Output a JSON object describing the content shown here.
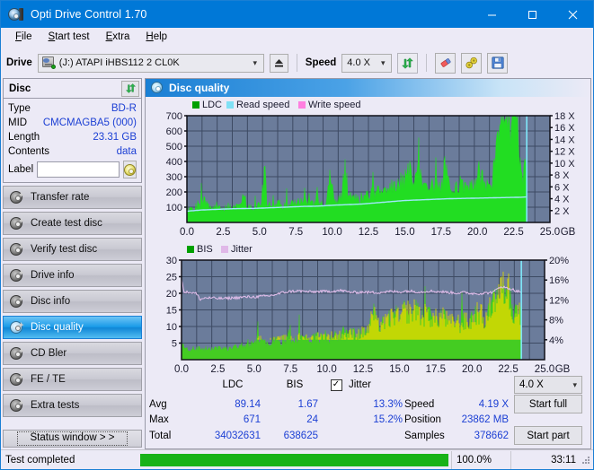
{
  "window": {
    "title": "Opti Drive Control 1.70",
    "icon": "disc-drive-icon",
    "minimize": "minimize",
    "maximize": "maximize",
    "close": "close"
  },
  "menu": [
    {
      "label": "File",
      "accel": "F"
    },
    {
      "label": "Start test",
      "accel": "S"
    },
    {
      "label": "Extra",
      "accel": "E"
    },
    {
      "label": "Help",
      "accel": "H"
    }
  ],
  "toolbar": {
    "drive_label": "Drive",
    "drive_value": "(J:)  ATAPI iHBS112  2 CL0K",
    "eject_icon": "eject-icon",
    "speed_label": "Speed",
    "speed_value": "4.0 X",
    "refresh_icon": "refresh-icon",
    "eraser_icon": "eraser-icon",
    "tools_icon": "tools-icon",
    "save_icon": "save-icon"
  },
  "disc": {
    "title": "Disc",
    "refresh_icon": "refresh-icon",
    "rows": [
      {
        "key": "Type",
        "value": "BD-R"
      },
      {
        "key": "MID",
        "value": "CMCMAGBA5 (000)"
      },
      {
        "key": "Length",
        "value": "23.31 GB"
      },
      {
        "key": "Contents",
        "value": "data"
      }
    ],
    "label_key": "Label",
    "label_value": "",
    "label_placeholder": "",
    "label_btn_icon": "disc-icon"
  },
  "nav": {
    "items": [
      {
        "label": "Transfer rate",
        "icon": "disc-icon",
        "active": false
      },
      {
        "label": "Create test disc",
        "icon": "disc-icon",
        "active": false
      },
      {
        "label": "Verify test disc",
        "icon": "disc-icon",
        "active": false
      },
      {
        "label": "Drive info",
        "icon": "disc-icon",
        "active": false
      },
      {
        "label": "Disc info",
        "icon": "disc-icon",
        "active": false
      },
      {
        "label": "Disc quality",
        "icon": "disc-icon",
        "active": true
      },
      {
        "label": "CD Bler",
        "icon": "disc-icon",
        "active": false
      },
      {
        "label": "FE / TE",
        "icon": "disc-icon",
        "active": false
      },
      {
        "label": "Extra tests",
        "icon": "disc-icon",
        "active": false
      }
    ],
    "status_window": "Status window > >"
  },
  "panel": {
    "title": "Disc quality",
    "icon": "disc-quality-icon"
  },
  "stats": {
    "col_headers": [
      "LDC",
      "BIS"
    ],
    "jitter_label": "Jitter",
    "jitter_checked": true,
    "rows": [
      {
        "key": "Avg",
        "ldc": "89.14",
        "bis": "1.67",
        "jitter": "13.3%"
      },
      {
        "key": "Max",
        "ldc": "671",
        "bis": "24",
        "jitter": "15.2%"
      },
      {
        "key": "Total",
        "ldc": "34032631",
        "bis": "638625",
        "jitter": ""
      }
    ],
    "speed_key": "Speed",
    "speed_value": "4.19 X",
    "position_key": "Position",
    "position_value": "23862 MB",
    "samples_key": "Samples",
    "samples_value": "378662",
    "speed_select": "4.0 X",
    "start_full": "Start full",
    "start_part": "Start part"
  },
  "statusbar": {
    "message": "Test completed",
    "percent": "100.0%",
    "elapsed": "33:11",
    "progress": 100
  },
  "colors": {
    "accent": "#0078d7",
    "plot_bg": "#6b7c9b",
    "ldc_green": "#22dd22",
    "bis_green": "#22cc22",
    "bis_yellow": "#d4d400",
    "read_speed": "#7fe0f5",
    "write_speed": "#ff7fe0",
    "jitter": "#e0b8e8",
    "value_blue": "#1b3fd4"
  },
  "chart_data": [
    {
      "id": "ldc-chart",
      "type": "area",
      "title": "",
      "xlabel": "GB",
      "ylabel": "",
      "xlim": [
        0,
        25
      ],
      "xticks": [
        "0.0",
        "2.5",
        "5.0",
        "7.5",
        "10.0",
        "12.5",
        "15.0",
        "17.5",
        "20.0",
        "22.5",
        "25.0"
      ],
      "ylim": [
        0,
        700
      ],
      "yticks": [
        "100",
        "200",
        "300",
        "400",
        "500",
        "600",
        "700"
      ],
      "y2lim": [
        0,
        18
      ],
      "y2ticks": [
        "2 X",
        "4 X",
        "6 X",
        "8 X",
        "10 X",
        "12 X",
        "14 X",
        "16 X",
        "18 X"
      ],
      "legend": [
        {
          "name": "LDC",
          "color": "#00a000"
        },
        {
          "name": "Read speed",
          "color": "#7fe0f5"
        },
        {
          "name": "Write speed",
          "color": "#ff7fe0"
        }
      ],
      "legend_position": "top-left",
      "grid": true,
      "data_end_gb": 23.4,
      "series": [
        {
          "name": "LDC",
          "kind": "area",
          "color": "#22dd22",
          "x": [
            0.0,
            0.3,
            0.6,
            0.9,
            1.2,
            1.5,
            1.8,
            2.1,
            2.4,
            2.7,
            3.0,
            3.3,
            3.6,
            3.9,
            4.2,
            4.5,
            4.8,
            5.1,
            5.4,
            5.5,
            5.7,
            6.0,
            6.3,
            6.6,
            6.9,
            7.2,
            7.5,
            7.8,
            8.1,
            8.4,
            8.7,
            9.0,
            9.3,
            9.6,
            9.9,
            10.0,
            10.3,
            10.6,
            10.9,
            11.0,
            11.3,
            11.6,
            11.9,
            12.2,
            12.5,
            12.8,
            13.1,
            13.4,
            13.7,
            14.0,
            14.3,
            14.6,
            14.9,
            15.2,
            15.5,
            15.8,
            16.0,
            16.3,
            16.6,
            16.9,
            17.2,
            17.5,
            17.8,
            18.0,
            18.3,
            18.6,
            18.9,
            19.2,
            19.5,
            19.8,
            20.1,
            20.4,
            20.7,
            21.0,
            21.3,
            21.6,
            21.9,
            22.1,
            22.3,
            22.5,
            22.7,
            22.9,
            23.1,
            23.3,
            23.4
          ],
          "values": [
            70,
            78,
            80,
            100,
            160,
            95,
            85,
            110,
            80,
            105,
            95,
            85,
            120,
            185,
            90,
            95,
            110,
            100,
            370,
            120,
            105,
            115,
            120,
            100,
            110,
            125,
            130,
            115,
            180,
            120,
            110,
            135,
            140,
            120,
            320,
            200,
            140,
            150,
            330,
            160,
            150,
            160,
            150,
            165,
            170,
            175,
            185,
            200,
            215,
            230,
            250,
            265,
            240,
            330,
            300,
            270,
            330,
            280,
            250,
            230,
            240,
            230,
            350,
            240,
            230,
            220,
            230,
            240,
            250,
            245,
            330,
            250,
            240,
            260,
            420,
            580,
            620,
            670,
            560,
            640,
            600,
            380,
            250,
            480,
            160
          ]
        },
        {
          "name": "Read speed",
          "kind": "line",
          "color": "#9fe8fa",
          "axis": "right",
          "x": [
            0.0,
            1.0,
            2.0,
            3.0,
            4.0,
            5.0,
            6.0,
            7.0,
            8.0,
            9.0,
            10.0,
            11.0,
            12.0,
            13.0,
            14.0,
            15.0,
            16.0,
            17.0,
            18.0,
            19.0,
            20.0,
            21.0,
            22.0,
            23.0,
            23.4
          ],
          "values": [
            1.9,
            2.1,
            2.2,
            2.3,
            2.35,
            2.4,
            2.5,
            2.6,
            2.7,
            2.75,
            2.9,
            3.0,
            3.1,
            3.3,
            3.5,
            3.7,
            3.8,
            3.9,
            4.0,
            4.05,
            4.1,
            4.15,
            4.2,
            4.25,
            4.3
          ]
        },
        {
          "name": "Write speed",
          "kind": "line",
          "color": "#ff7fe0",
          "x": [],
          "values": []
        }
      ]
    },
    {
      "id": "bis-jitter-chart",
      "type": "area",
      "title": "",
      "xlabel": "GB",
      "ylabel": "",
      "xlim": [
        0,
        25
      ],
      "xticks": [
        "0.0",
        "2.5",
        "5.0",
        "7.5",
        "10.0",
        "12.5",
        "15.0",
        "17.5",
        "20.0",
        "22.5",
        "25.0"
      ],
      "ylim": [
        0,
        30
      ],
      "yticks": [
        "5",
        "10",
        "15",
        "20",
        "25",
        "30"
      ],
      "y2lim": [
        0,
        20
      ],
      "y2ticks": [
        "4%",
        "8%",
        "12%",
        "16%",
        "20%"
      ],
      "legend": [
        {
          "name": "BIS",
          "color": "#00a000"
        },
        {
          "name": "Jitter",
          "color": "#e0b8e8"
        }
      ],
      "legend_position": "top-left",
      "grid": true,
      "data_end_gb": 23.4,
      "series": [
        {
          "name": "BIS",
          "kind": "area",
          "color": "#44cc22",
          "x": [
            0.0,
            0.3,
            0.6,
            0.9,
            1.2,
            1.5,
            1.8,
            2.1,
            2.4,
            2.7,
            3.0,
            3.3,
            3.6,
            3.9,
            4.2,
            4.5,
            4.8,
            5.1,
            5.4,
            5.7,
            6.0,
            6.3,
            6.6,
            6.9,
            7.2,
            7.5,
            7.8,
            8.1,
            8.4,
            8.7,
            9.0,
            9.3,
            9.6,
            9.9,
            10.2,
            10.5,
            10.8,
            11.1,
            11.4,
            11.7,
            12.0,
            12.3,
            12.6,
            12.9,
            13.2,
            13.5,
            13.8,
            14.1,
            14.4,
            14.7,
            15.0,
            15.3,
            15.6,
            15.9,
            16.2,
            16.5,
            16.8,
            17.1,
            17.4,
            17.7,
            18.0,
            18.3,
            18.6,
            18.9,
            19.2,
            19.5,
            19.8,
            20.1,
            20.4,
            20.7,
            21.0,
            21.3,
            21.6,
            21.9,
            22.1,
            22.3,
            22.5,
            22.7,
            22.9,
            23.1,
            23.3,
            23.4
          ],
          "values": [
            4.5,
            3.2,
            3.0,
            3.4,
            3.2,
            3.1,
            3.3,
            3.0,
            3.2,
            3.4,
            3.1,
            3.3,
            3.6,
            3.4,
            4.0,
            3.8,
            4.4,
            4.6,
            6.0,
            4.8,
            5.0,
            5.2,
            5.4,
            5.6,
            5.8,
            6.0,
            5.6,
            6.2,
            5.8,
            6.4,
            6.0,
            6.6,
            6.2,
            6.8,
            6.4,
            7.0,
            6.6,
            7.2,
            6.8,
            7.4,
            7.0,
            7.6,
            7.8,
            9.0,
            13.5,
            9.5,
            11.0,
            10.5,
            12.0,
            13.0,
            11.5,
            13.5,
            14.0,
            13.5,
            15.0,
            12.0,
            13.0,
            12.5,
            11.5,
            12.0,
            13.0,
            11.0,
            10.5,
            11.5,
            10.0,
            11.0,
            10.5,
            11.5,
            14.0,
            12.5,
            11.0,
            15.5,
            17.0,
            19.5,
            21.0,
            19.0,
            21.5,
            15.0,
            13.0,
            14.5,
            14.0,
            8.0
          ]
        },
        {
          "name": "Jitter",
          "kind": "line",
          "color": "#e6c0ee",
          "axis": "right",
          "x": [
            0.0,
            0.2,
            0.5,
            1.0,
            1.3,
            1.6,
            2.0,
            2.5,
            3.0,
            3.5,
            4.0,
            4.5,
            5.0,
            5.5,
            6.0,
            6.5,
            7.0,
            7.5,
            8.0,
            8.5,
            9.0,
            9.5,
            10.0,
            10.5,
            11.0,
            11.5,
            12.0,
            12.5,
            13.0,
            13.5,
            14.0,
            14.5,
            15.0,
            15.5,
            16.0,
            16.5,
            17.0,
            17.5,
            18.0,
            18.5,
            19.0,
            19.5,
            20.0,
            20.5,
            21.0,
            21.5,
            22.0,
            22.3,
            22.6,
            22.9,
            23.1
          ],
          "values": [
            16.2,
            13.5,
            13.6,
            13.3,
            12.1,
            12.4,
            12.4,
            12.3,
            12.3,
            12.4,
            12.5,
            12.6,
            12.6,
            12.7,
            12.8,
            13.1,
            13.5,
            13.7,
            13.8,
            13.7,
            13.6,
            13.7,
            13.7,
            13.8,
            13.9,
            13.6,
            13.5,
            13.6,
            13.5,
            13.5,
            13.6,
            13.7,
            13.6,
            13.8,
            13.7,
            13.6,
            13.8,
            13.7,
            13.6,
            13.5,
            13.4,
            13.5,
            13.3,
            13.3,
            13.4,
            13.6,
            14.8,
            14.4,
            14.3,
            14.0,
            13.7
          ]
        }
      ]
    }
  ]
}
